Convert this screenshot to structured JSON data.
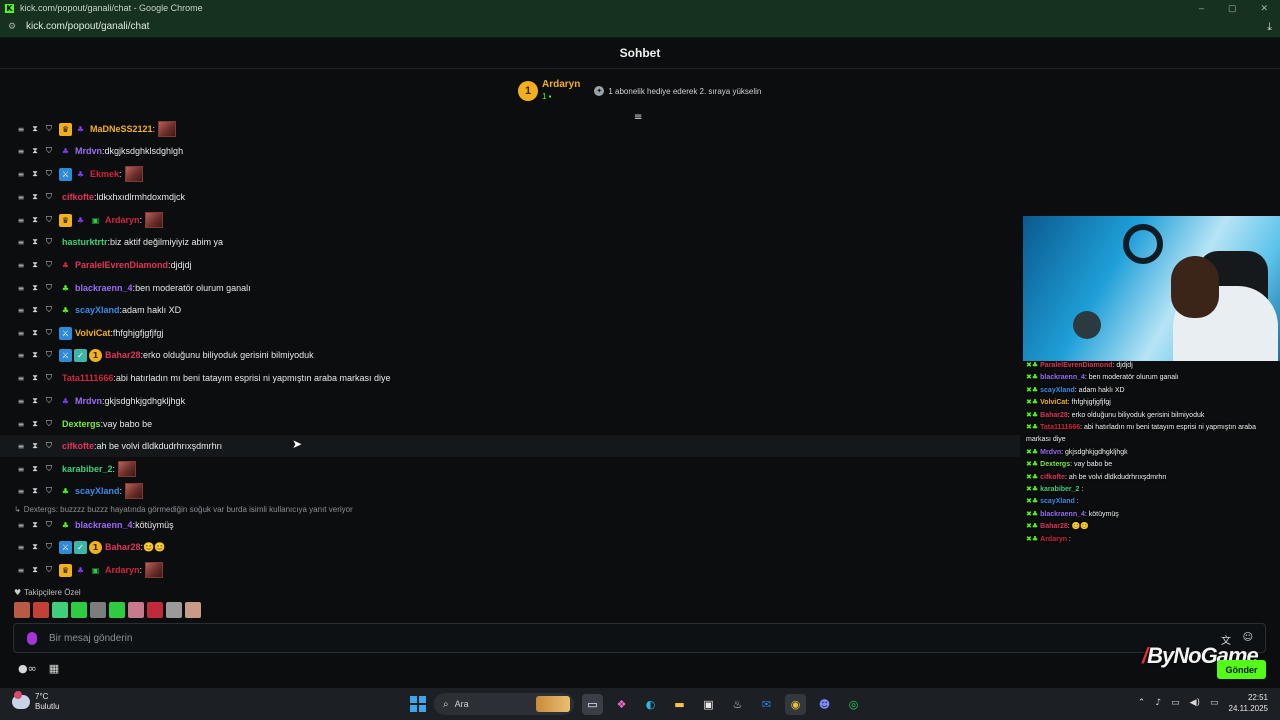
{
  "window": {
    "title": "kick.com/popout/ganali/chat - Google Chrome",
    "url": "kick.com/popout/ganali/chat",
    "controls": [
      "–",
      "▢",
      "✕"
    ]
  },
  "chat": {
    "title": "Sohbet"
  },
  "leaderboard": {
    "rank": "1",
    "name": "Ardaryn",
    "count": "1",
    "hint": "1 abonelik hediye ederek 2. sıraya yükselin"
  },
  "messages": [
    {
      "badges": [
        "crown",
        "sub-purple"
      ],
      "user": "MaDNeSS2121",
      "color": "#f2b01e",
      "text": "",
      "emote": true
    },
    {
      "badges": [
        "sub-purple"
      ],
      "user": "Mrdvn",
      "color": "#9a6bf5",
      "text": "dkgjksdghklsdghlgh",
      "emote": false
    },
    {
      "badges": [
        "mod-blue",
        "sub-purple"
      ],
      "user": "Ekmek",
      "color": "#d1263e",
      "text": "",
      "emote": true
    },
    {
      "badges": [],
      "user": "cifkofte",
      "color": "#e0355a",
      "text": "ldkxhxıdlrmhdoxmdjck",
      "emote": false
    },
    {
      "badges": [
        "crown",
        "sub-purple",
        "gift"
      ],
      "user": "Ardaryn",
      "color": "#d1263e",
      "text": "",
      "emote": true
    },
    {
      "badges": [],
      "user": "hasturktrtr",
      "color": "#3fcf7b",
      "text": "biz aktif değilmiyiyiz abim ya",
      "emote": false
    },
    {
      "badges": [
        "sub-red"
      ],
      "user": "ParalelEvrenDiamond",
      "color": "#e0355a",
      "text": "djdjdj",
      "emote": false
    },
    {
      "badges": [
        "sub-green"
      ],
      "user": "blackraenn_4",
      "color": "#9a6bf5",
      "text": "ben moderatör olurum ganalı",
      "emote": false
    },
    {
      "badges": [
        "sub-green"
      ],
      "user": "scayXland",
      "color": "#3a8de8",
      "text": "adam haklı XD",
      "emote": false
    },
    {
      "badges": [
        "mod-blue"
      ],
      "user": "VolviCat",
      "color": "#f2b01e",
      "text": "fhfghjgfjgfjfgj",
      "emote": false
    },
    {
      "badges": [
        "mod-blue",
        "verified",
        "rank1"
      ],
      "user": "Bahar28",
      "color": "#e0355a",
      "text": "erko olduğunu biliyoduk gerisini bilmiyoduk",
      "emote": false
    },
    {
      "badges": [],
      "user": "Tata1111666",
      "color": "#d1263e",
      "text": "abi hatırladın mı beni tatayım esprisi ni yapmıştın araba markası diye",
      "emote": false
    },
    {
      "badges": [
        "sub-purple"
      ],
      "user": "Mrdvn",
      "color": "#9a6bf5",
      "text": "gkjsdghkjgdhgkljhgk",
      "emote": false
    },
    {
      "badges": [],
      "user": "Dextergs",
      "color": "#7dea3a",
      "text": "vay babo be",
      "emote": false
    },
    {
      "badges": [],
      "user": "cifkofte",
      "color": "#e0355a",
      "text": "ah be volvi dldkdudrhrıxşdmrhrı",
      "emote": false
    },
    {
      "badges": [],
      "user": "karabiber_2",
      "color": "#3fcf7b",
      "text": "",
      "emote": true
    },
    {
      "badges": [
        "sub-green"
      ],
      "user": "scayXland",
      "color": "#3a8de8",
      "text": "",
      "emote": true
    },
    {
      "badges": [
        "sub-green"
      ],
      "user": "blackraenn_4",
      "color": "#9a6bf5",
      "text": "kötüymüş",
      "emote": false
    },
    {
      "badges": [
        "mod-blue",
        "verified",
        "rank1"
      ],
      "user": "Bahar28",
      "color": "#e0355a",
      "text": "😊😊",
      "emote": false
    },
    {
      "badges": [
        "crown",
        "sub-purple",
        "gift"
      ],
      "user": "Ardaryn",
      "color": "#d1263e",
      "text": "",
      "emote": true
    }
  ],
  "reply": {
    "text": "Dextergs: buzzzz buzzz hayatında görmediğin soğuk var burda isimli kullanıcıya yanıt veriyor"
  },
  "followers": {
    "label": "Takipçilere Özel",
    "emotes": [
      "#b85a44",
      "#c24135",
      "#3fcf7b",
      "#2ecc40",
      "#7d7d7d",
      "#2ecc40",
      "#c87a8c",
      "#c02a3a",
      "#9a9a9a",
      "#c89a88"
    ]
  },
  "input": {
    "placeholder": "Bir mesaj gönderin"
  },
  "send": {
    "label": "Gönder"
  },
  "watermark": {
    "text": "ByNoGame"
  },
  "overlay_chat": [
    {
      "user": "ParalelEvrenDiamond",
      "color": "#e0355a",
      "text": ": djdjdj"
    },
    {
      "user": "blackraenn_4",
      "color": "#9a6bf5",
      "text": ": ben moderatör olurum ganalı"
    },
    {
      "user": "scayXland",
      "color": "#3a8de8",
      "text": ": adam haklı XD"
    },
    {
      "user": "VolviCat",
      "color": "#f2b01e",
      "text": ": fhfghjgfjgfjfgj"
    },
    {
      "user": "Bahar28",
      "color": "#e0355a",
      "text": ": erko olduğunu biliyoduk gerisini bilmiyoduk"
    },
    {
      "user": "Tata1111666",
      "color": "#d1263e",
      "text": ": abi hatırladın mı beni tatayım esprisi ni yapmıştın araba"
    },
    {
      "user": "",
      "color": "#ffffff",
      "text": "markası diye"
    },
    {
      "user": "Mrdvn",
      "color": "#9a6bf5",
      "text": ": gkjsdghkjgdhgkljhgk"
    },
    {
      "user": "Dextergs",
      "color": "#7dea3a",
      "text": ": vay babo be"
    },
    {
      "user": "cifkofte",
      "color": "#e0355a",
      "text": ": ah be volvi dldkdudrhrıxşdmrhrı"
    },
    {
      "user": "karabiber_2",
      "color": "#3fcf7b",
      "text": " :"
    },
    {
      "user": "scayXland",
      "color": "#3a8de8",
      "text": " :"
    },
    {
      "user": "blackraenn_4",
      "color": "#9a6bf5",
      "text": ": kötüymüş"
    },
    {
      "user": "Bahar28",
      "color": "#e0355a",
      "text": ": 😊😊"
    },
    {
      "user": "Ardaryn",
      "color": "#d1263e",
      "text": " :"
    }
  ],
  "taskbar": {
    "weather_temp": "7°C",
    "weather_desc": "Bulutlu",
    "search": "Ara",
    "time": "22:51",
    "date": "24.11.2025"
  },
  "colors": {
    "accent": "#53fc18",
    "background": "#0b0d0e",
    "gold": "#f2b01e"
  }
}
